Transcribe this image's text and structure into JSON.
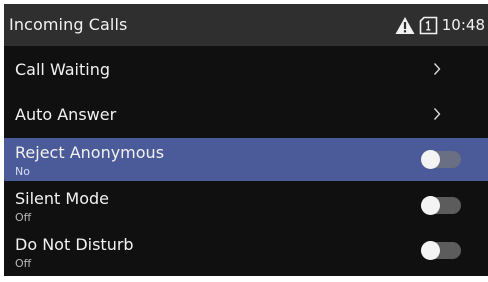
{
  "header": {
    "title": "Incoming Calls",
    "time": "10:48",
    "status_icons": [
      "warning-icon",
      "sim-card-icon"
    ]
  },
  "menu": {
    "items": [
      {
        "label": "Call Waiting",
        "type": "submenu"
      },
      {
        "label": "Auto Answer",
        "type": "submenu"
      },
      {
        "label": "Reject Anonymous",
        "value": "No",
        "type": "toggle",
        "on": false,
        "selected": true
      },
      {
        "label": "Silent Mode",
        "value": "Off",
        "type": "toggle",
        "on": false,
        "selected": false
      },
      {
        "label": "Do Not Disturb",
        "value": "Off",
        "type": "toggle",
        "on": false,
        "selected": false
      }
    ]
  },
  "colors": {
    "background": "#101010",
    "header": "#2f2f2f",
    "selected_row": "#4b5b9a",
    "toggle_track": "#5c5c5c",
    "toggle_knob": "#f4f4f4"
  }
}
